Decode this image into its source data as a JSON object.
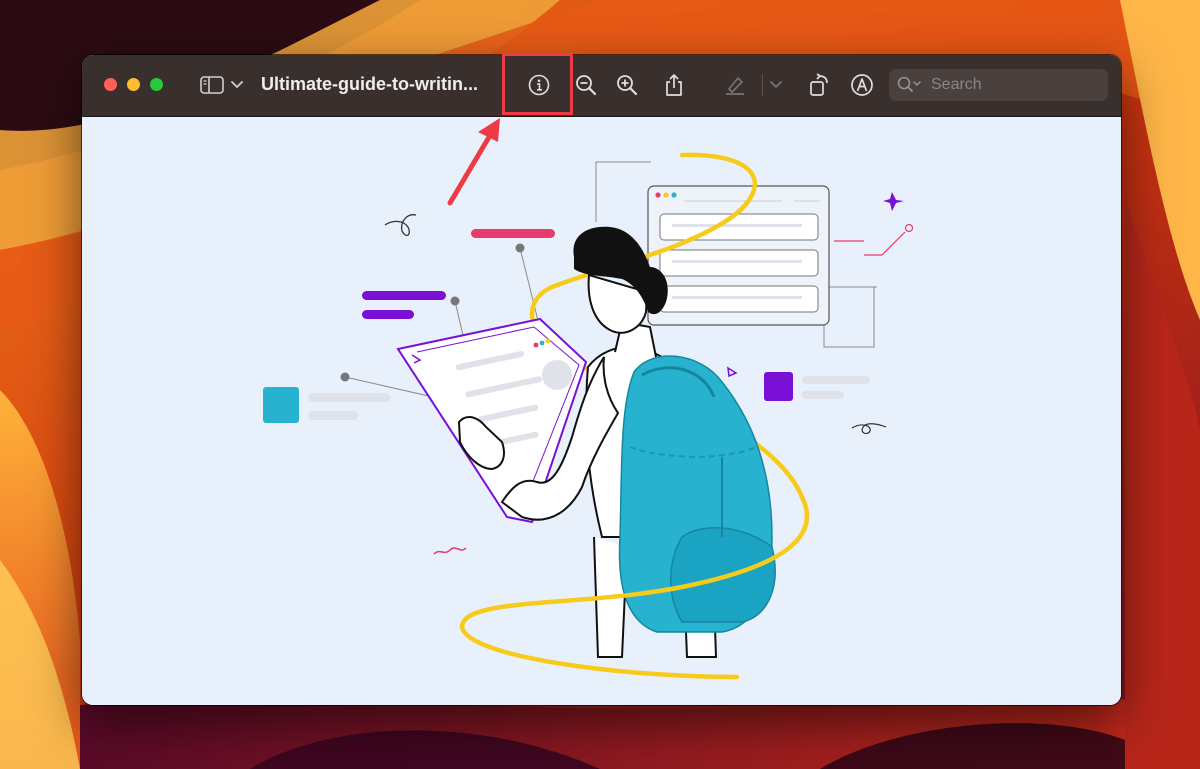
{
  "window": {
    "title": "Ultimate-guide-to-writin...",
    "search": {
      "placeholder": "Search",
      "value": ""
    }
  },
  "toolbar": {
    "icons": [
      "sidebar-icon",
      "chevron-down-icon",
      "info-icon",
      "zoom-out-icon",
      "zoom-in-icon",
      "share-icon",
      "highlight-pen-icon",
      "chevron-down-icon",
      "rotate-icon",
      "markup-icon",
      "search-icon"
    ]
  },
  "annotation": {
    "color": "#ee3a44",
    "target": "info-icon"
  },
  "colors": {
    "toolbar_bg": "#39302e",
    "canvas_bg": "#e8f1fb",
    "backpack": "#27b3d0",
    "yellow_swirl": "#f7cb1c",
    "purple": "#7a10d6",
    "pink": "#e83a6b"
  }
}
